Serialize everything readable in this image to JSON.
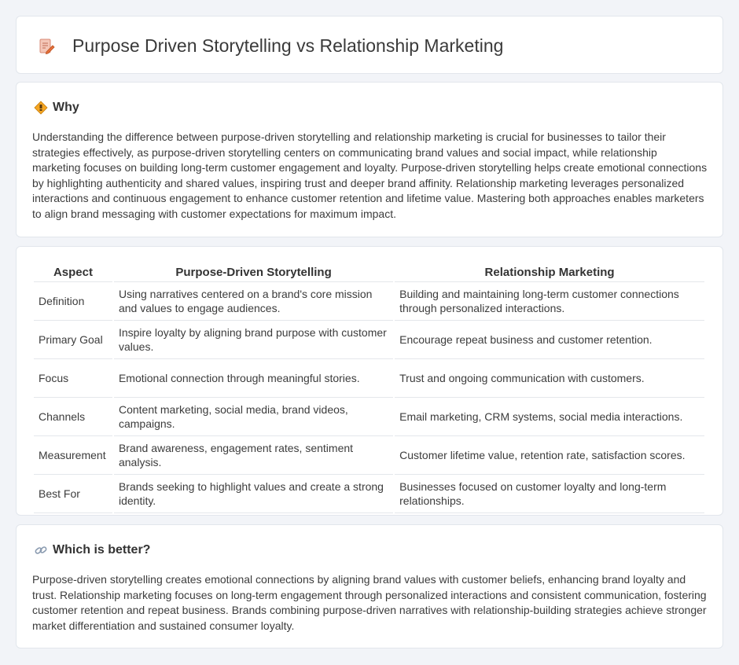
{
  "header": {
    "title": "Purpose Driven Storytelling vs Relationship Marketing",
    "icon": "document-pencil-icon"
  },
  "why": {
    "heading": "Why",
    "icon": "diamond-sign-icon",
    "text": "Understanding the difference between purpose-driven storytelling and relationship marketing is crucial for businesses to tailor their strategies effectively, as purpose-driven storytelling centers on communicating brand values and social impact, while relationship marketing focuses on building long-term customer engagement and loyalty. Purpose-driven storytelling helps create emotional connections by highlighting authenticity and shared values, inspiring trust and deeper brand affinity. Relationship marketing leverages personalized interactions and continuous engagement to enhance customer retention and lifetime value. Mastering both approaches enables marketers to align brand messaging with customer expectations for maximum impact."
  },
  "comparison": {
    "headers": [
      "Aspect",
      "Purpose-Driven Storytelling",
      "Relationship Marketing"
    ],
    "rows": [
      [
        "Definition",
        "Using narratives centered on a brand's core mission and values to engage audiences.",
        "Building and maintaining long-term customer connections through personalized interactions."
      ],
      [
        "Primary Goal",
        "Inspire loyalty by aligning brand purpose with customer values.",
        "Encourage repeat business and customer retention."
      ],
      [
        "Focus",
        "Emotional connection through meaningful stories.",
        "Trust and ongoing communication with customers."
      ],
      [
        "Channels",
        "Content marketing, social media, brand videos, campaigns.",
        "Email marketing, CRM systems, social media interactions."
      ],
      [
        "Measurement",
        "Brand awareness, engagement rates, sentiment analysis.",
        "Customer lifetime value, retention rate, satisfaction scores."
      ],
      [
        "Best For",
        "Brands seeking to highlight values and create a strong identity.",
        "Businesses focused on customer loyalty and long-term relationships."
      ]
    ]
  },
  "better": {
    "heading": "Which is better?",
    "icon": "link-icon",
    "text": "Purpose-driven storytelling creates emotional connections by aligning brand values with customer beliefs, enhancing brand loyalty and trust. Relationship marketing focuses on long-term engagement through personalized interactions and consistent communication, fostering customer retention and repeat business. Brands combining purpose-driven narratives with relationship-building strategies achieve stronger market differentiation and sustained consumer loyalty."
  }
}
